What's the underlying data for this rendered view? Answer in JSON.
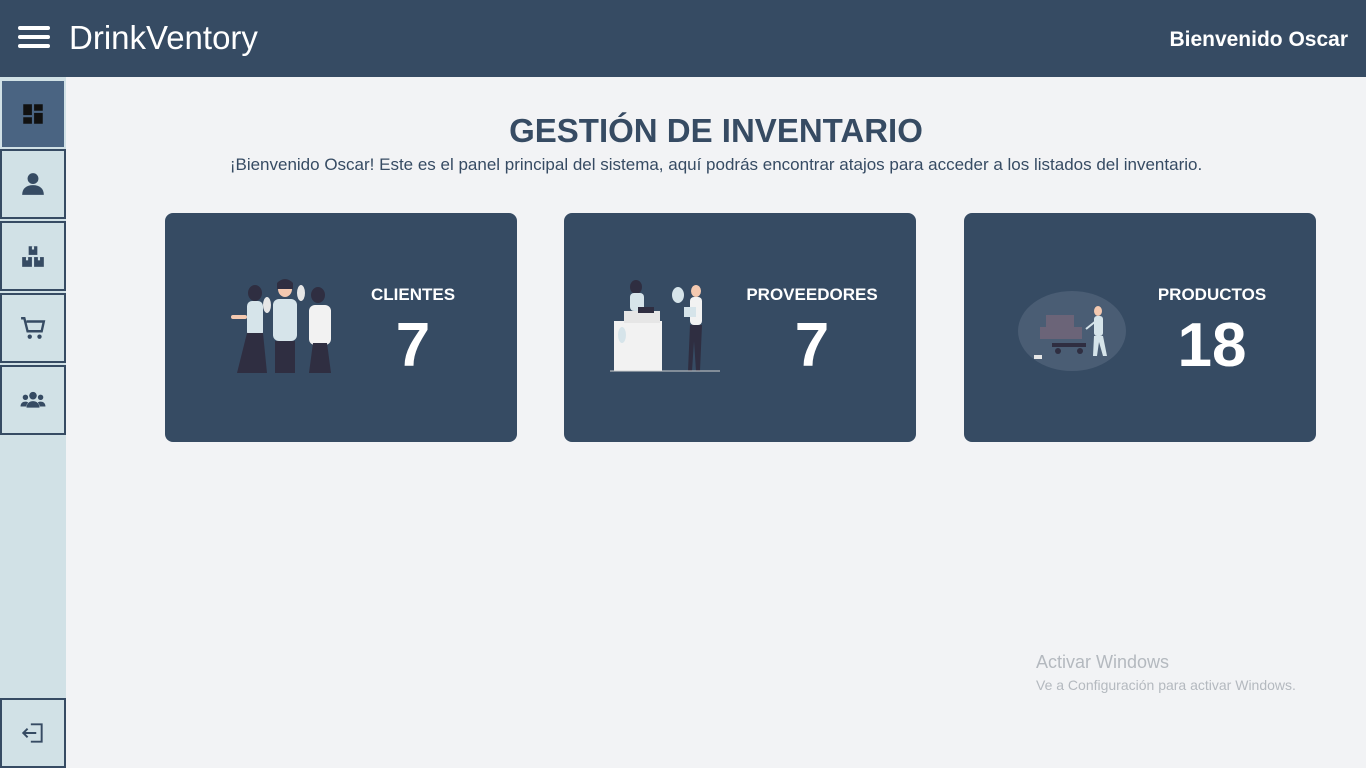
{
  "header": {
    "brand": "DrinkVentory",
    "welcome": "Bienvenido Oscar"
  },
  "sidebar": {
    "items": [
      {
        "icon": "dashboard-icon",
        "active": true
      },
      {
        "icon": "user-icon"
      },
      {
        "icon": "boxes-icon"
      },
      {
        "icon": "cart-icon"
      },
      {
        "icon": "users-group-icon"
      }
    ],
    "logout_icon": "logout-icon"
  },
  "main": {
    "title": "GESTIÓN DE INVENTARIO",
    "subtitle": "¡Bienvenido Oscar! Este es el panel principal del sistema, aquí podrás encontrar atajos para acceder a los listados del inventario."
  },
  "cards": [
    {
      "label": "CLIENTES",
      "count": "7"
    },
    {
      "label": "PROVEEDORES",
      "count": "7"
    },
    {
      "label": "PRODUCTOS",
      "count": "18"
    }
  ],
  "watermark": {
    "title": "Activar Windows",
    "subtitle": "Ve a Configuración para activar Windows."
  },
  "colors": {
    "primary": "#364b63",
    "sidebar": "#d1e1e6",
    "background": "#f2f3f5"
  }
}
